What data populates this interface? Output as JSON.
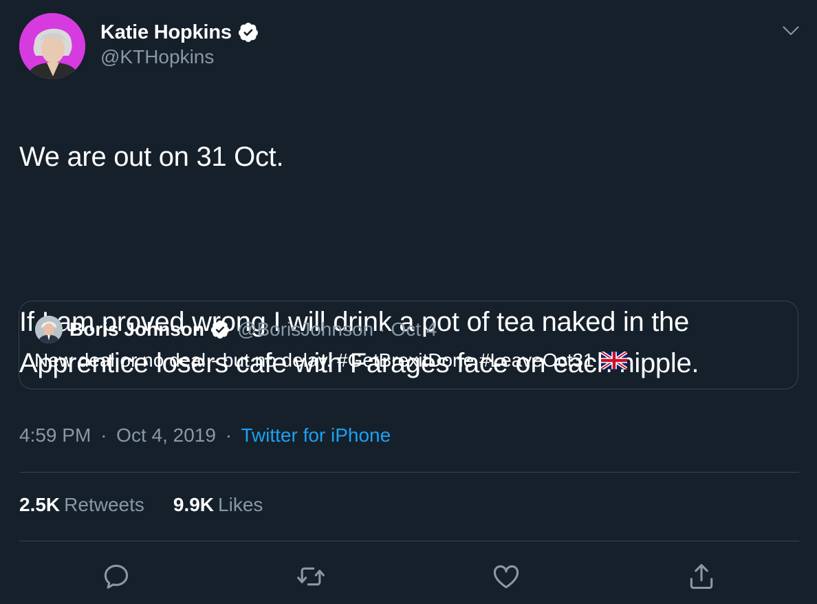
{
  "author": {
    "name": "Katie Hopkins",
    "handle": "@KTHopkins",
    "verified": true
  },
  "tweet": {
    "line1": "We are out on 31 Oct.",
    "line2": "If I am proved wrong I will drink a pot of tea naked in the Apprentice losers cafe with Farages face on each nipple."
  },
  "quote": {
    "name": "Boris Johnson",
    "handle": "@BorisJohnson",
    "separator": "·",
    "date": "Oct 4",
    "text": "New deal or no deal - but no delay. #GetBrexitDone #LeaveOct31",
    "emoji": "uk-flag"
  },
  "meta": {
    "time": "4:59 PM",
    "separator": "·",
    "date": "Oct 4, 2019",
    "source": "Twitter for iPhone"
  },
  "stats": {
    "retweets_count": "2.5K",
    "retweets_label": "Retweets",
    "likes_count": "9.9K",
    "likes_label": "Likes"
  },
  "actions": [
    "reply-icon",
    "retweet-icon",
    "like-icon",
    "share-icon"
  ],
  "colors": {
    "background": "#15202b",
    "text": "#ffffff",
    "secondary": "#8899a6",
    "link": "#1da1f2",
    "border": "#38444d",
    "verified": "#ffffff"
  }
}
